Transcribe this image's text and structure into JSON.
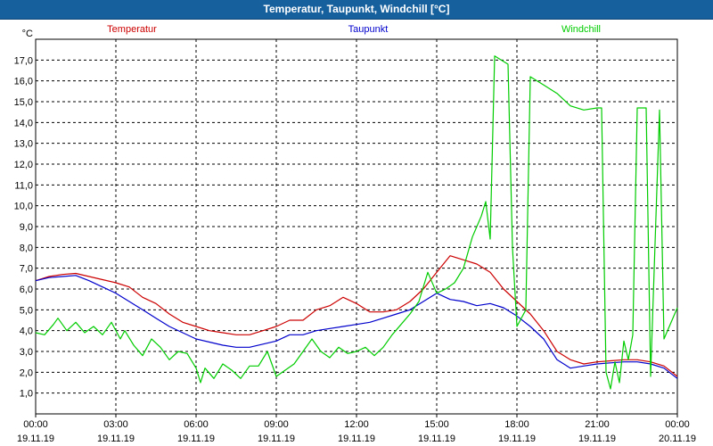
{
  "window": {
    "title": "Temperatur, Taupunkt, Windchill [°C]"
  },
  "chart_data": {
    "type": "line",
    "title": "Temperatur, Taupunkt, Windchill [°C]",
    "ylabel": "°C",
    "ylim": [
      0.0,
      18.0
    ],
    "yticks": [
      "1,0",
      "2,0",
      "3,0",
      "4,0",
      "5,0",
      "6,0",
      "7,0",
      "8,0",
      "9,0",
      "10,0",
      "11,0",
      "12,0",
      "13,0",
      "14,0",
      "15,0",
      "16,0",
      "17,0"
    ],
    "xticks": [
      {
        "time": "00:00",
        "date": "19.11.19"
      },
      {
        "time": "03:00",
        "date": "19.11.19"
      },
      {
        "time": "06:00",
        "date": "19.11.19"
      },
      {
        "time": "09:00",
        "date": "19.11.19"
      },
      {
        "time": "12:00",
        "date": "19.11.19"
      },
      {
        "time": "15:00",
        "date": "19.11.19"
      },
      {
        "time": "18:00",
        "date": "19.11.19"
      },
      {
        "time": "21:00",
        "date": "19.11.19"
      },
      {
        "time": "00:00",
        "date": "20.11.19"
      }
    ],
    "xlim": [
      "19.11.19 00:00",
      "20.11.19 00:00"
    ],
    "grid": true,
    "legend_position": "top",
    "series": [
      {
        "name": "Temperatur",
        "color": "#cc0000",
        "points": [
          [
            "19.11.19 00:00",
            6.4
          ],
          [
            "19.11.19 00:30",
            6.6
          ],
          [
            "19.11.19 01:00",
            6.7
          ],
          [
            "19.11.19 01:30",
            6.75
          ],
          [
            "19.11.19 02:00",
            6.6
          ],
          [
            "19.11.19 02:30",
            6.45
          ],
          [
            "19.11.19 03:00",
            6.3
          ],
          [
            "19.11.19 03:30",
            6.1
          ],
          [
            "19.11.19 04:00",
            5.6
          ],
          [
            "19.11.19 04:30",
            5.3
          ],
          [
            "19.11.19 05:00",
            4.8
          ],
          [
            "19.11.19 05:30",
            4.4
          ],
          [
            "19.11.19 06:00",
            4.2
          ],
          [
            "19.11.19 06:30",
            4.0
          ],
          [
            "19.11.19 07:00",
            3.9
          ],
          [
            "19.11.19 07:30",
            3.8
          ],
          [
            "19.11.19 08:00",
            3.8
          ],
          [
            "19.11.19 08:30",
            4.0
          ],
          [
            "19.11.19 09:00",
            4.2
          ],
          [
            "19.11.19 09:30",
            4.5
          ],
          [
            "19.11.19 10:00",
            4.5
          ],
          [
            "19.11.19 10:30",
            5.0
          ],
          [
            "19.11.19 11:00",
            5.2
          ],
          [
            "19.11.19 11:30",
            5.6
          ],
          [
            "19.11.19 12:00",
            5.3
          ],
          [
            "19.11.19 12:30",
            4.9
          ],
          [
            "19.11.19 13:00",
            4.9
          ],
          [
            "19.11.19 13:30",
            5.0
          ],
          [
            "19.11.19 14:00",
            5.4
          ],
          [
            "19.11.19 14:30",
            6.0
          ],
          [
            "19.11.19 15:00",
            6.8
          ],
          [
            "19.11.19 15:30",
            7.6
          ],
          [
            "19.11.19 16:00",
            7.4
          ],
          [
            "19.11.19 16:30",
            7.2
          ],
          [
            "19.11.19 17:00",
            6.8
          ],
          [
            "19.11.19 17:30",
            6.0
          ],
          [
            "19.11.19 18:00",
            5.4
          ],
          [
            "19.11.19 18:30",
            4.8
          ],
          [
            "19.11.19 19:00",
            4.0
          ],
          [
            "19.11.19 19:30",
            3.0
          ],
          [
            "19.11.19 20:00",
            2.6
          ],
          [
            "19.11.19 20:30",
            2.4
          ],
          [
            "19.11.19 21:00",
            2.5
          ],
          [
            "19.11.19 21:30",
            2.55
          ],
          [
            "19.11.19 22:00",
            2.6
          ],
          [
            "19.11.19 22:30",
            2.6
          ],
          [
            "19.11.19 23:00",
            2.5
          ],
          [
            "19.11.19 23:30",
            2.3
          ],
          [
            "20.11.19 00:00",
            1.8
          ]
        ]
      },
      {
        "name": "Taupunkt",
        "color": "#0000cc",
        "points": [
          [
            "19.11.19 00:00",
            6.4
          ],
          [
            "19.11.19 00:30",
            6.55
          ],
          [
            "19.11.19 01:00",
            6.6
          ],
          [
            "19.11.19 01:30",
            6.65
          ],
          [
            "19.11.19 02:00",
            6.4
          ],
          [
            "19.11.19 02:30",
            6.1
          ],
          [
            "19.11.19 03:00",
            5.8
          ],
          [
            "19.11.19 03:30",
            5.4
          ],
          [
            "19.11.19 04:00",
            5.0
          ],
          [
            "19.11.19 04:30",
            4.6
          ],
          [
            "19.11.19 05:00",
            4.2
          ],
          [
            "19.11.19 05:30",
            3.9
          ],
          [
            "19.11.19 06:00",
            3.6
          ],
          [
            "19.11.19 06:30",
            3.45
          ],
          [
            "19.11.19 07:00",
            3.3
          ],
          [
            "19.11.19 07:30",
            3.2
          ],
          [
            "19.11.19 08:00",
            3.2
          ],
          [
            "19.11.19 08:30",
            3.35
          ],
          [
            "19.11.19 09:00",
            3.5
          ],
          [
            "19.11.19 09:30",
            3.8
          ],
          [
            "19.11.19 10:00",
            3.8
          ],
          [
            "19.11.19 10:30",
            4.0
          ],
          [
            "19.11.19 11:00",
            4.1
          ],
          [
            "19.11.19 11:30",
            4.2
          ],
          [
            "19.11.19 12:00",
            4.3
          ],
          [
            "19.11.19 12:30",
            4.4
          ],
          [
            "19.11.19 13:00",
            4.6
          ],
          [
            "19.11.19 13:30",
            4.8
          ],
          [
            "19.11.19 14:00",
            5.0
          ],
          [
            "19.11.19 14:30",
            5.4
          ],
          [
            "19.11.19 15:00",
            5.8
          ],
          [
            "19.11.19 15:30",
            5.5
          ],
          [
            "19.11.19 16:00",
            5.4
          ],
          [
            "19.11.19 16:30",
            5.2
          ],
          [
            "19.11.19 17:00",
            5.3
          ],
          [
            "19.11.19 17:30",
            5.1
          ],
          [
            "19.11.19 18:00",
            4.7
          ],
          [
            "19.11.19 18:30",
            4.2
          ],
          [
            "19.11.19 19:00",
            3.6
          ],
          [
            "19.11.19 19:30",
            2.6
          ],
          [
            "19.11.19 20:00",
            2.2
          ],
          [
            "19.11.19 20:30",
            2.3
          ],
          [
            "19.11.19 21:00",
            2.4
          ],
          [
            "19.11.19 21:30",
            2.45
          ],
          [
            "19.11.19 22:00",
            2.5
          ],
          [
            "19.11.19 22:30",
            2.5
          ],
          [
            "19.11.19 23:00",
            2.4
          ],
          [
            "19.11.19 23:30",
            2.2
          ],
          [
            "20.11.19 00:00",
            1.7
          ]
        ]
      },
      {
        "name": "Windchill",
        "color": "#00cc00",
        "points": [
          [
            "19.11.19 00:00",
            3.9
          ],
          [
            "19.11.19 00:20",
            3.8
          ],
          [
            "19.11.19 00:40",
            4.3
          ],
          [
            "19.11.19 00:50",
            4.6
          ],
          [
            "19.11.19 01:10",
            4.0
          ],
          [
            "19.11.19 01:30",
            4.4
          ],
          [
            "19.11.19 01:50",
            3.9
          ],
          [
            "19.11.19 02:10",
            4.2
          ],
          [
            "19.11.19 02:30",
            3.8
          ],
          [
            "19.11.19 02:50",
            4.4
          ],
          [
            "19.11.19 03:10",
            3.6
          ],
          [
            "19.11.19 03:20",
            4.0
          ],
          [
            "19.11.19 03:40",
            3.3
          ],
          [
            "19.11.19 04:00",
            2.8
          ],
          [
            "19.11.19 04:20",
            3.6
          ],
          [
            "19.11.19 04:40",
            3.2
          ],
          [
            "19.11.19 05:00",
            2.6
          ],
          [
            "19.11.19 05:20",
            3.0
          ],
          [
            "19.11.19 05:40",
            2.9
          ],
          [
            "19.11.19 06:00",
            2.2
          ],
          [
            "19.11.19 06:10",
            1.5
          ],
          [
            "19.11.19 06:20",
            2.2
          ],
          [
            "19.11.19 06:40",
            1.7
          ],
          [
            "19.11.19 07:00",
            2.4
          ],
          [
            "19.11.19 07:20",
            2.1
          ],
          [
            "19.11.19 07:40",
            1.7
          ],
          [
            "19.11.19 08:00",
            2.3
          ],
          [
            "19.11.19 08:20",
            2.3
          ],
          [
            "19.11.19 08:40",
            3.0
          ],
          [
            "19.11.19 09:00",
            1.8
          ],
          [
            "19.11.19 09:20",
            2.1
          ],
          [
            "19.11.19 09:40",
            2.4
          ],
          [
            "19.11.19 10:00",
            3.0
          ],
          [
            "19.11.19 10:20",
            3.6
          ],
          [
            "19.11.19 10:40",
            3.0
          ],
          [
            "19.11.19 11:00",
            2.7
          ],
          [
            "19.11.19 11:20",
            3.2
          ],
          [
            "19.11.19 11:40",
            2.9
          ],
          [
            "19.11.19 12:00",
            3.0
          ],
          [
            "19.11.19 12:20",
            3.2
          ],
          [
            "19.11.19 12:40",
            2.8
          ],
          [
            "19.11.19 13:00",
            3.2
          ],
          [
            "19.11.19 13:20",
            3.8
          ],
          [
            "19.11.19 13:40",
            4.3
          ],
          [
            "19.11.19 14:00",
            4.8
          ],
          [
            "19.11.19 14:20",
            5.4
          ],
          [
            "19.11.19 14:40",
            6.8
          ],
          [
            "19.11.19 15:00",
            5.8
          ],
          [
            "19.11.19 15:20",
            6.0
          ],
          [
            "19.11.19 15:40",
            6.3
          ],
          [
            "19.11.19 16:00",
            7.0
          ],
          [
            "19.11.19 16:20",
            8.5
          ],
          [
            "19.11.19 16:40",
            9.5
          ],
          [
            "19.11.19 16:50",
            10.2
          ],
          [
            "19.11.19 17:00",
            8.4
          ],
          [
            "19.11.19 17:10",
            17.2
          ],
          [
            "19.11.19 17:40",
            16.8
          ],
          [
            "19.11.19 17:50",
            8.0
          ],
          [
            "19.11.19 18:00",
            4.2
          ],
          [
            "19.11.19 18:20",
            5.0
          ],
          [
            "19.11.19 18:30",
            16.2
          ],
          [
            "19.11.19 19:00",
            15.8
          ],
          [
            "19.11.19 19:30",
            15.4
          ],
          [
            "19.11.19 20:00",
            14.8
          ],
          [
            "19.11.19 20:30",
            14.6
          ],
          [
            "19.11.19 21:00",
            14.7
          ],
          [
            "19.11.19 21:10",
            14.7
          ],
          [
            "19.11.19 21:20",
            2.0
          ],
          [
            "19.11.19 21:30",
            1.2
          ],
          [
            "19.11.19 21:40",
            2.5
          ],
          [
            "19.11.19 21:50",
            1.5
          ],
          [
            "19.11.19 22:00",
            3.5
          ],
          [
            "19.11.19 22:10",
            2.6
          ],
          [
            "19.11.19 22:20",
            3.8
          ],
          [
            "19.11.19 22:30",
            14.7
          ],
          [
            "19.11.19 22:50",
            14.7
          ],
          [
            "19.11.19 23:00",
            1.8
          ],
          [
            "19.11.19 23:20",
            14.6
          ],
          [
            "19.11.19 23:30",
            3.6
          ],
          [
            "20.11.19 00:00",
            5.1
          ]
        ]
      }
    ]
  }
}
